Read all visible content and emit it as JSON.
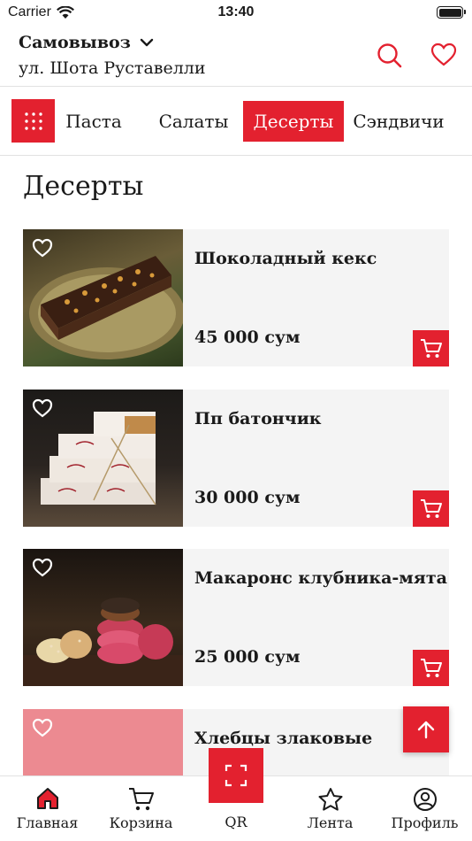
{
  "status_bar": {
    "carrier": "Carrier",
    "time": "13:40"
  },
  "header": {
    "delivery_mode": "Самовывоз",
    "address": "ул. Шота Руставелли"
  },
  "categories": [
    {
      "label": "Паста",
      "active": false
    },
    {
      "label": "Салаты",
      "active": false
    },
    {
      "label": "Десерты",
      "active": true
    },
    {
      "label": "Сэндвичи",
      "active": false
    }
  ],
  "section_title": "Десерты",
  "products": [
    {
      "name": "Шоколадный кекс",
      "price": "45 000 сум"
    },
    {
      "name": "Пп батончик",
      "price": "30 000 сум"
    },
    {
      "name": "Макаронс клубника-мята",
      "price": "25 000 сум"
    },
    {
      "name": "Хлебцы злаковые",
      "price": ""
    }
  ],
  "bottom_nav": {
    "home": "Главная",
    "cart": "Корзина",
    "qr": "QR",
    "feed": "Лента",
    "profile": "Профиль"
  },
  "colors": {
    "accent": "#e3212f",
    "card_bg": "#f4f4f4"
  }
}
